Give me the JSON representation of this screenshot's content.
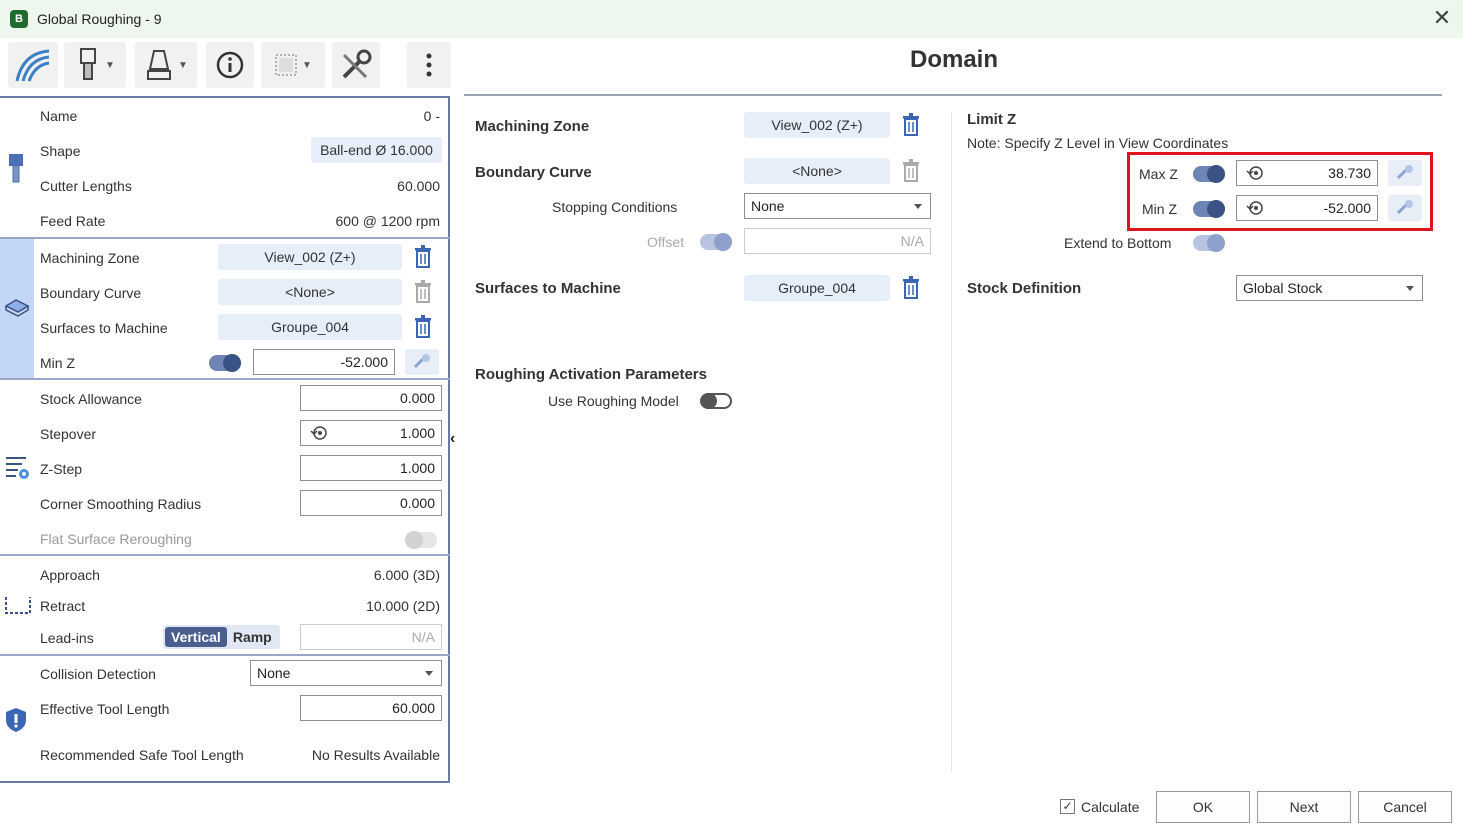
{
  "window": {
    "title": "Global Roughing - 9",
    "app_icon": "B"
  },
  "left": {
    "tool": {
      "name_label": "Name",
      "name_value": "0 -",
      "shape_label": "Shape",
      "shape_value": "Ball-end Ø 16.000",
      "cutter_label": "Cutter Lengths",
      "cutter_value": "60.000",
      "feed_label": "Feed Rate",
      "feed_value": "600 @ 1200 rpm"
    },
    "domain": {
      "zone_label": "Machining Zone",
      "zone_value": "View_002 (Z+)",
      "boundary_label": "Boundary Curve",
      "boundary_value": "<None>",
      "surfaces_label": "Surfaces to Machine",
      "surfaces_value": "Groupe_004",
      "minz_label": "Min Z",
      "minz_value": "-52.000"
    },
    "params": {
      "stock_label": "Stock Allowance",
      "stock_value": "0.000",
      "stepover_label": "Stepover",
      "stepover_value": "1.000",
      "zstep_label": "Z-Step",
      "zstep_value": "1.000",
      "corner_label": "Corner Smoothing Radius",
      "corner_value": "0.000",
      "flat_label": "Flat Surface Reroughing"
    },
    "links": {
      "approach_label": "Approach",
      "approach_value": "6.000 (3D)",
      "retract_label": "Retract",
      "retract_value": "10.000 (2D)",
      "leadins_label": "Lead-ins",
      "leadins_opt1": "Vertical",
      "leadins_opt2": "Ramp",
      "leadins_value": "N/A"
    },
    "safety": {
      "collision_label": "Collision Detection",
      "collision_value": "None",
      "eff_label": "Effective Tool Length",
      "eff_value": "60.000",
      "rec_label": "Recommended Safe Tool Length",
      "rec_value": "No Results Available"
    }
  },
  "main": {
    "title": "Domain",
    "zone_label": "Machining Zone",
    "zone_value": "View_002 (Z+)",
    "boundary_label": "Boundary Curve",
    "boundary_value": "<None>",
    "stopping_label": "Stopping Conditions",
    "stopping_value": "None",
    "offset_label": "Offset",
    "offset_value": "N/A",
    "surfaces_label": "Surfaces to Machine",
    "surfaces_value": "Groupe_004",
    "roughing_label": "Roughing Activation Parameters",
    "use_model_label": "Use Roughing Model",
    "limitz_label": "Limit Z",
    "note": "Note: Specify Z Level in View Coordinates",
    "maxz_label": "Max Z",
    "maxz_value": "38.730",
    "minz_label": "Min Z",
    "minz_value": "-52.000",
    "extend_label": "Extend to Bottom",
    "stockdef_label": "Stock Definition",
    "stockdef_value": "Global Stock"
  },
  "footer": {
    "calculate_label": "Calculate",
    "calculate_check": "✓",
    "ok": "OK",
    "next": "Next",
    "cancel": "Cancel"
  },
  "colors": {
    "accent": "#3b5285",
    "highlight": "#e0141e",
    "pill": "#e6eefa"
  }
}
